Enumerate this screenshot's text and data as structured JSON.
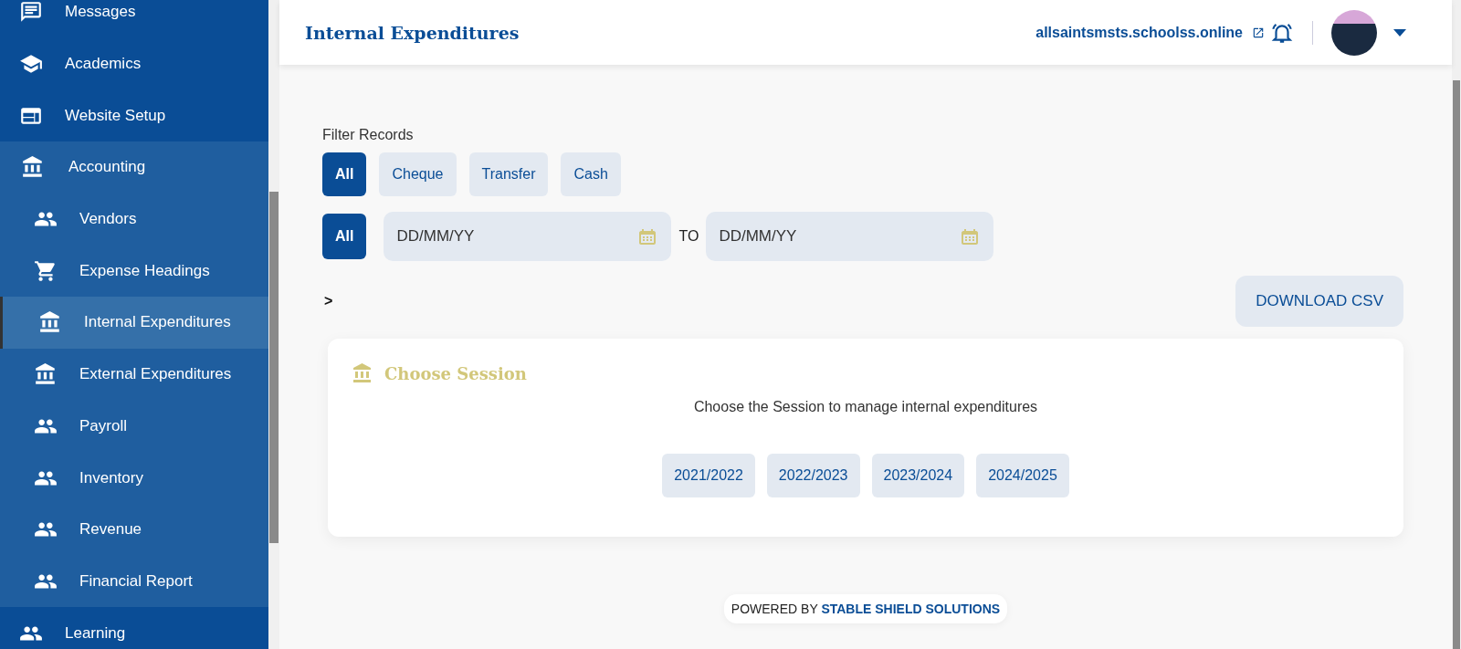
{
  "sidebar": {
    "items": [
      {
        "kind": "chat",
        "label": "Messages",
        "selected": false
      },
      {
        "kind": "school",
        "label": "Academics",
        "selected": false
      },
      {
        "kind": "web",
        "label": "Website Setup",
        "selected": false
      },
      {
        "kind": "bank",
        "label": "Accounting",
        "selected": false,
        "expanded": true,
        "children": [
          {
            "kind": "people",
            "label": "Vendors",
            "selected": false
          },
          {
            "kind": "cart",
            "label": "Expense Headings",
            "selected": false
          },
          {
            "kind": "bank",
            "label": "Internal Expenditures",
            "selected": true
          },
          {
            "kind": "bank",
            "label": "External Expenditures",
            "selected": false
          },
          {
            "kind": "people",
            "label": "Payroll",
            "selected": false
          },
          {
            "kind": "people",
            "label": "Inventory",
            "selected": false
          },
          {
            "kind": "people",
            "label": "Revenue",
            "selected": false
          },
          {
            "kind": "people",
            "label": "Financial Report",
            "selected": false
          }
        ]
      },
      {
        "kind": "people",
        "label": "Learning",
        "selected": false
      }
    ]
  },
  "header": {
    "title": "Internal Expenditures",
    "site_link": "allsaintsmsts.schoolss.online"
  },
  "filter": {
    "title": "Filter Records",
    "payment_types": [
      {
        "label": "All",
        "selected": true
      },
      {
        "label": "Cheque",
        "selected": false
      },
      {
        "label": "Transfer",
        "selected": false
      },
      {
        "label": "Cash",
        "selected": false
      }
    ],
    "date_all": {
      "label": "All",
      "selected": true
    },
    "from_date": {
      "placeholder": "DD/MM/YY"
    },
    "to_label": "TO",
    "to_date": {
      "placeholder": "DD/MM/YY"
    },
    "breadcrumb": ">",
    "download_button": "DOWNLOAD CSV"
  },
  "session_card": {
    "title": "Choose Session",
    "description": "Choose the Session to manage internal expenditures",
    "sessions": [
      "2021/2022",
      "2022/2023",
      "2023/2024",
      "2024/2025"
    ]
  },
  "footer": "POWERED BY **STABLE SHIELD SOLUTIONS**"
}
